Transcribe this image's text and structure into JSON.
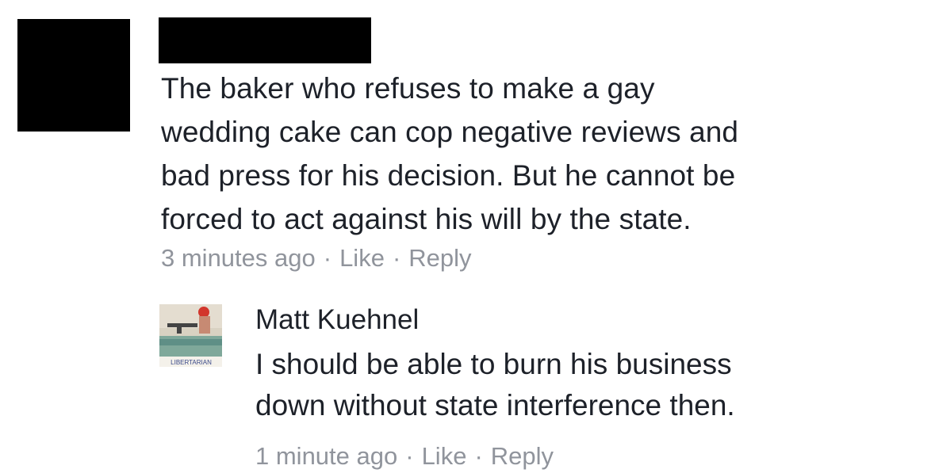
{
  "comment": {
    "lines": [
      "The baker who refuses to make a gay",
      "wedding cake can cop negative reviews and",
      "bad press for his decision. But he cannot be",
      "forced to act against his will by the state."
    ],
    "timestamp": "3 minutes ago",
    "separator": "·",
    "like_label": "Like",
    "reply_label": "Reply"
  },
  "reply": {
    "author": "Matt Kuehnel",
    "avatar_caption": "LIBERTARIAN",
    "lines": [
      "I should be able to burn his business",
      "down without state interference then."
    ],
    "timestamp": "1 minute ago",
    "separator": "·",
    "like_label": "Like",
    "reply_label": "Reply"
  },
  "colors": {
    "text": "#1d2129",
    "meta": "#90949c",
    "redaction": "#000000"
  }
}
